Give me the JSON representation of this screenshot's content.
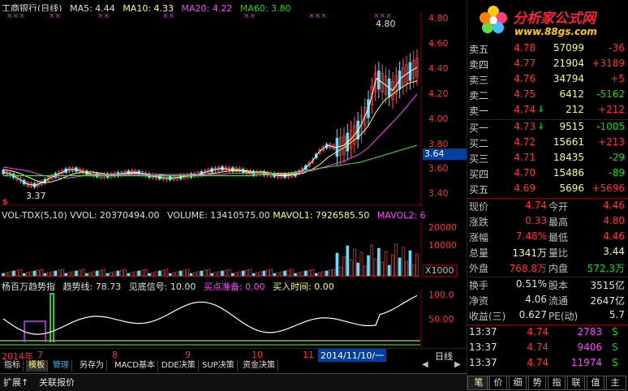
{
  "header": {
    "title": "工商银行(日线)",
    "ma5": "MA5: 4.44",
    "ma10": "MA10: 4.33",
    "ma20": "MA20: 4.22",
    "ma60": "MA60: 3.80"
  },
  "price_axis": [
    "4.80",
    "4.60",
    "4.40",
    "4.20",
    "4.00",
    "3.80",
    "3.60",
    "3.40"
  ],
  "price_marker": "3.64",
  "annotations": {
    "high_label": "4.80",
    "low_label": "3.37",
    "s_marker": "S"
  },
  "logo": {
    "brand": "分析家公式网",
    "url": "www.88gs.com"
  },
  "order_book": {
    "sell": [
      {
        "label": "卖五",
        "price": "4.78",
        "vol": "57099",
        "chg": "-36"
      },
      {
        "label": "卖四",
        "price": "4.77",
        "vol": "21904",
        "chg": "+3189"
      },
      {
        "label": "卖三",
        "price": "4.76",
        "vol": "34794",
        "chg": "+5"
      },
      {
        "label": "卖二",
        "price": "4.75",
        "vol": "6412",
        "chg": "-5162"
      },
      {
        "label": "卖一",
        "price": "4.74",
        "vol": "212",
        "chg": "+212",
        "arrow": "↓"
      }
    ],
    "buy": [
      {
        "label": "买一",
        "price": "4.73",
        "vol": "9515",
        "chg": "-1005",
        "arrow": "↓"
      },
      {
        "label": "买二",
        "price": "4.72",
        "vol": "15661",
        "chg": "+213"
      },
      {
        "label": "买三",
        "price": "4.71",
        "vol": "18435",
        "chg": "-29"
      },
      {
        "label": "买四",
        "price": "4.70",
        "vol": "15486",
        "chg": "-89"
      },
      {
        "label": "买五",
        "price": "4.69",
        "vol": "5696",
        "chg": "+5696"
      }
    ]
  },
  "quote": {
    "xianshou_label": "现价",
    "xianshou": "4.74",
    "jinkai_label": "今开",
    "jinkai": "4.46",
    "zhangdie_label": "涨跌",
    "zhangdie": "0.33",
    "zuigao_label": "最高",
    "zuigao": "4.80",
    "zhangfu_label": "涨幅",
    "zhangfu": "7.48%",
    "zuidi_label": "最低",
    "zuidi": "4.46",
    "zongliang_label": "总量",
    "zongliang": "1341万",
    "liangbi_label": "量比",
    "liangbi": "3.44",
    "waipan_label": "外盘",
    "waipan": "768.8万",
    "neipan_label": "内盘",
    "neipan": "572.3万"
  },
  "stats": {
    "huanshou_label": "换手",
    "huanshou": "0.51%",
    "guben_label": "股本",
    "guben": "3515亿",
    "jingzi_label": "净资",
    "jingzi": "4.06",
    "liutong_label": "流通",
    "liutong": "2647亿",
    "shouyi_label": "收益(三)",
    "shouyi": "0.627",
    "pe_label": "PE(动)",
    "pe": "5.7"
  },
  "ticks": [
    {
      "time": "13:37",
      "price": "4.74",
      "vol": "2783",
      "side": "S"
    },
    {
      "time": "13:37",
      "price": "4.74",
      "vol": "9406",
      "side": "S"
    },
    {
      "time": "13:37",
      "price": "4.74",
      "vol": "11974",
      "side": "S"
    }
  ],
  "volume_panel": {
    "title": "VOL-TDX(5,10)",
    "vvol": "VVOL: 20370494.00",
    "volume": "VOLUME: 13410575.00",
    "mavol1": "MAVOL1: 7926585.50",
    "mavol2": "MAVOL2: 6",
    "axis": [
      "20000",
      "10000"
    ],
    "unit": "X1000"
  },
  "indicator_panel": {
    "title": "杨百万趋势指",
    "trend": "趋势线: 78.73",
    "bottom": "见底信号: 10.00",
    "prepare": "买点准备: 0.00",
    "buytime": "买入时间: 0.00",
    "axis": [
      "100.0",
      "50.00"
    ]
  },
  "time_axis": {
    "labels": [
      "2014年",
      "7",
      "8",
      "9",
      "10",
      "11"
    ],
    "current": "2014/11/10/一",
    "period": "日线"
  },
  "bottom_tabs": [
    "指标",
    "模板",
    "管理",
    "另存为",
    "MACD基本",
    "DDE决策",
    "SUP决策",
    "资金决策"
  ],
  "bottom_tabs2": [
    "扩展↑",
    "关联报价"
  ],
  "right_tabs": [
    "笔",
    "价",
    "细",
    "势",
    "指",
    "联",
    "值",
    "主"
  ],
  "chart_data": {
    "type": "line",
    "title": "工商银行(日线)",
    "ylim": [
      3.3,
      4.9
    ],
    "series": [
      {
        "name": "MA5",
        "values": [
          3.58,
          3.56,
          3.52,
          3.48,
          3.47,
          3.5,
          3.54,
          3.57,
          3.6,
          3.6,
          3.58,
          3.56,
          3.55,
          3.55,
          3.56,
          3.57,
          3.58,
          3.57,
          3.55,
          3.54,
          3.53,
          3.53,
          3.54,
          3.55,
          3.56,
          3.58,
          3.6,
          3.61,
          3.6,
          3.6,
          3.58,
          3.57,
          3.57,
          3.56,
          3.55,
          3.55,
          3.56,
          3.6,
          3.66,
          3.75,
          3.8,
          3.78,
          3.8,
          3.86,
          3.95,
          4.1,
          4.35,
          4.3,
          4.25,
          4.35,
          4.4,
          4.44
        ]
      },
      {
        "name": "MA10",
        "values": [
          3.6,
          3.59,
          3.57,
          3.54,
          3.51,
          3.49,
          3.5,
          3.52,
          3.55,
          3.57,
          3.58,
          3.58,
          3.57,
          3.56,
          3.56,
          3.56,
          3.57,
          3.57,
          3.56,
          3.56,
          3.55,
          3.55,
          3.55,
          3.55,
          3.55,
          3.56,
          3.57,
          3.58,
          3.59,
          3.59,
          3.59,
          3.58,
          3.58,
          3.57,
          3.56,
          3.56,
          3.56,
          3.57,
          3.6,
          3.64,
          3.7,
          3.74,
          3.78,
          3.83,
          3.88,
          3.96,
          4.08,
          4.17,
          4.22,
          4.27,
          4.31,
          4.33
        ]
      },
      {
        "name": "MA20",
        "values": [
          3.62,
          3.61,
          3.6,
          3.59,
          3.57,
          3.55,
          3.54,
          3.53,
          3.53,
          3.54,
          3.55,
          3.56,
          3.56,
          3.56,
          3.56,
          3.56,
          3.56,
          3.56,
          3.56,
          3.56,
          3.56,
          3.56,
          3.56,
          3.56,
          3.56,
          3.56,
          3.56,
          3.56,
          3.57,
          3.57,
          3.57,
          3.57,
          3.57,
          3.57,
          3.57,
          3.57,
          3.57,
          3.58,
          3.59,
          3.61,
          3.63,
          3.65,
          3.67,
          3.7,
          3.73,
          3.78,
          3.85,
          3.92,
          3.99,
          4.06,
          4.14,
          4.22
        ]
      },
      {
        "name": "MA60",
        "values": [
          3.55,
          3.55,
          3.55,
          3.55,
          3.55,
          3.55,
          3.55,
          3.55,
          3.55,
          3.55,
          3.55,
          3.55,
          3.55,
          3.55,
          3.55,
          3.55,
          3.55,
          3.55,
          3.55,
          3.55,
          3.55,
          3.55,
          3.55,
          3.55,
          3.55,
          3.55,
          3.55,
          3.55,
          3.55,
          3.55,
          3.55,
          3.55,
          3.56,
          3.56,
          3.57,
          3.57,
          3.58,
          3.59,
          3.6,
          3.61,
          3.62,
          3.63,
          3.64,
          3.65,
          3.66,
          3.68,
          3.7,
          3.72,
          3.74,
          3.76,
          3.78,
          3.8
        ]
      }
    ]
  }
}
